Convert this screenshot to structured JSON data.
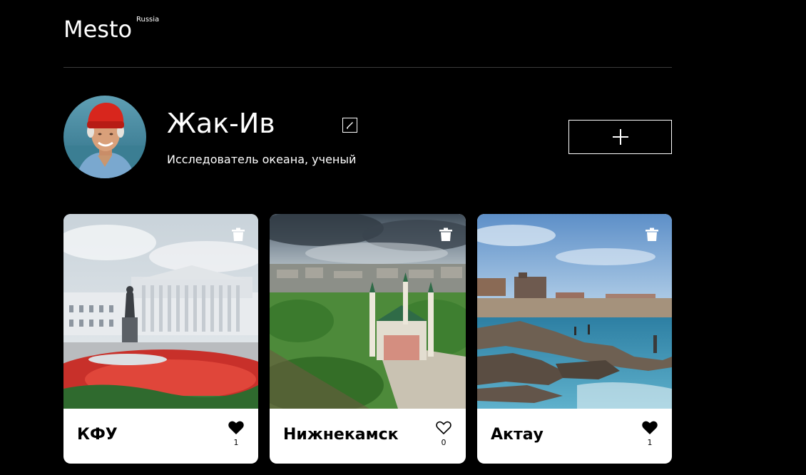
{
  "header": {
    "logo": "Mesto",
    "logo_sup": "Russia"
  },
  "profile": {
    "name": "Жак-Ив",
    "about": "Исследователь океана, ученый",
    "add_button_icon": "plus-icon",
    "edit_button_icon": "pencil-icon"
  },
  "cards": [
    {
      "title": "КФУ",
      "likes": "1",
      "liked": true
    },
    {
      "title": "Нижнекамск",
      "likes": "0",
      "liked": false
    },
    {
      "title": "Актау",
      "likes": "1",
      "liked": true
    }
  ],
  "colors": {
    "background": "#000000",
    "card": "#ffffff",
    "text_dark": "#000000",
    "text_light": "#ffffff"
  }
}
